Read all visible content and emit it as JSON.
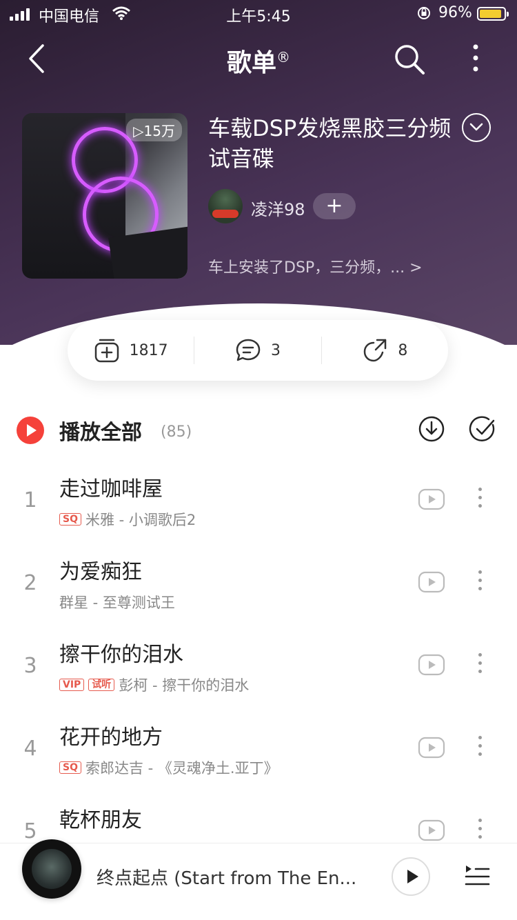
{
  "status_bar": {
    "carrier": "中国电信",
    "time": "上午5:45",
    "battery_pct": "96%"
  },
  "nav": {
    "title": "歌单",
    "title_mark": "®"
  },
  "playlist": {
    "play_count": "▷15万",
    "title": "车载DSP发烧黑胶三分频试音碟",
    "creator": "凌洋98",
    "follow_label": "+",
    "description": "车上安装了DSP，三分频，... >"
  },
  "stats": {
    "collect_count": "1817",
    "comment_count": "3",
    "share_count": "8"
  },
  "play_all": {
    "label": "播放全部",
    "count": "(85)"
  },
  "songs": [
    {
      "index": "1",
      "title": "走过咖啡屋",
      "badges": [
        "SQ"
      ],
      "subtitle": "米雅 - 小调歌后2"
    },
    {
      "index": "2",
      "title": "为爱痴狂",
      "badges": [],
      "subtitle": "群星 - 至尊测试王"
    },
    {
      "index": "3",
      "title": "擦干你的泪水",
      "badges": [
        "VIP",
        "试听"
      ],
      "subtitle": "彭柯 - 擦干你的泪水"
    },
    {
      "index": "4",
      "title": "花开的地方",
      "badges": [
        "SQ"
      ],
      "subtitle": "索郎达吉 - 《灵魂净土.亚丁》"
    },
    {
      "index": "5",
      "title": "乾杯朋友",
      "badges": [],
      "subtitle": ""
    }
  ],
  "mini_player": {
    "title": "终点起点 (Start from The En..."
  },
  "colors": {
    "accent_red": "#f5413a",
    "badge_red": "#e65a4d",
    "hero_purple": "#3d2a48",
    "battery_yellow": "#f3cc30"
  },
  "icons": {
    "back": "chevron-left-icon",
    "search": "search-icon",
    "more": "more-vertical-icon",
    "collect": "add-collection-icon",
    "comment": "comment-icon",
    "share": "share-icon",
    "download": "download-icon",
    "multi_select": "check-circle-icon",
    "playlist": "playlist-icon"
  }
}
